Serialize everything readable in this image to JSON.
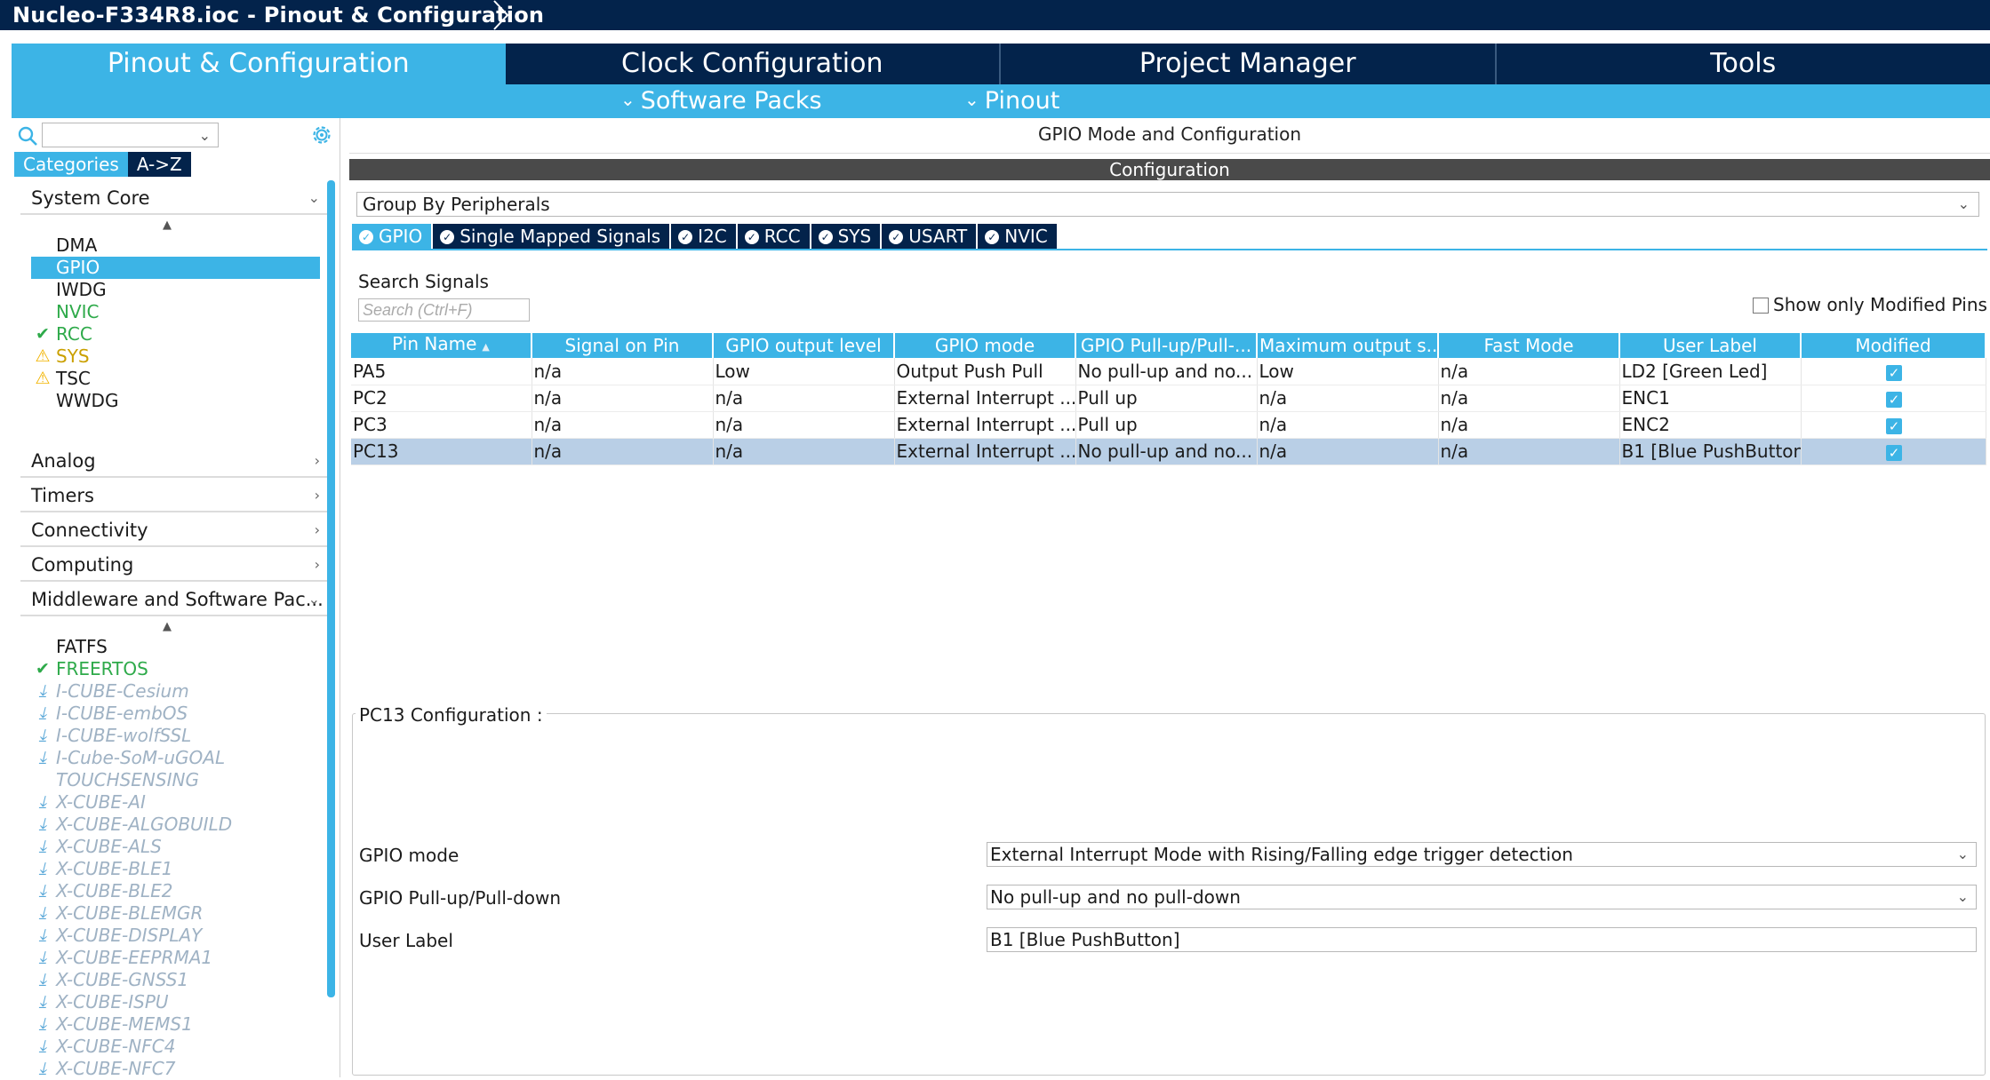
{
  "window": {
    "title": "Nucleo-F334R8.ioc - Pinout & Configuration"
  },
  "main_tabs": [
    {
      "label": "Pinout & Configuration",
      "active": true
    },
    {
      "label": "Clock Configuration",
      "active": false
    },
    {
      "label": "Project Manager",
      "active": false
    },
    {
      "label": "Tools",
      "active": false
    }
  ],
  "sub_tabs": [
    {
      "label": "Software Packs"
    },
    {
      "label": "Pinout"
    }
  ],
  "left_panel": {
    "search_value": "",
    "view_tabs": [
      "Categories",
      "A->Z"
    ],
    "system_core": {
      "title": "System Core",
      "items": [
        {
          "label": "DMA",
          "status": ""
        },
        {
          "label": "GPIO",
          "status": "selected"
        },
        {
          "label": "IWDG",
          "status": ""
        },
        {
          "label": "NVIC",
          "status": "green"
        },
        {
          "label": "RCC",
          "status": "check"
        },
        {
          "label": "SYS",
          "status": "warn"
        },
        {
          "label": "TSC",
          "status": "warn"
        },
        {
          "label": "WWDG",
          "status": ""
        }
      ]
    },
    "categories": [
      "Analog",
      "Timers",
      "Connectivity",
      "Computing"
    ],
    "middleware": {
      "title": "Middleware and Software Pac...",
      "items": [
        {
          "label": "FATFS",
          "status": ""
        },
        {
          "label": "FREERTOS",
          "status": "check"
        },
        {
          "label": "I-CUBE-Cesium",
          "status": "download"
        },
        {
          "label": "I-CUBE-embOS",
          "status": "download"
        },
        {
          "label": "I-CUBE-wolfSSL",
          "status": "download"
        },
        {
          "label": "I-Cube-SoM-uGOAL",
          "status": "download"
        },
        {
          "label": "TOUCHSENSING",
          "status": "disabled"
        },
        {
          "label": "X-CUBE-AI",
          "status": "download"
        },
        {
          "label": "X-CUBE-ALGOBUILD",
          "status": "download"
        },
        {
          "label": "X-CUBE-ALS",
          "status": "download"
        },
        {
          "label": "X-CUBE-BLE1",
          "status": "download"
        },
        {
          "label": "X-CUBE-BLE2",
          "status": "download"
        },
        {
          "label": "X-CUBE-BLEMGR",
          "status": "download"
        },
        {
          "label": "X-CUBE-DISPLAY",
          "status": "download"
        },
        {
          "label": "X-CUBE-EEPRMA1",
          "status": "download"
        },
        {
          "label": "X-CUBE-GNSS1",
          "status": "download"
        },
        {
          "label": "X-CUBE-ISPU",
          "status": "download"
        },
        {
          "label": "X-CUBE-MEMS1",
          "status": "download"
        },
        {
          "label": "X-CUBE-NFC4",
          "status": "download"
        },
        {
          "label": "X-CUBE-NFC7",
          "status": "download"
        }
      ]
    }
  },
  "right_panel": {
    "header": "GPIO Mode and Configuration",
    "config_title": "Configuration",
    "group_by": "Group By Peripherals",
    "peripheral_tabs": [
      {
        "label": "GPIO",
        "active": true
      },
      {
        "label": "Single Mapped Signals",
        "active": false
      },
      {
        "label": "I2C",
        "active": false
      },
      {
        "label": "RCC",
        "active": false
      },
      {
        "label": "SYS",
        "active": false
      },
      {
        "label": "USART",
        "active": false
      },
      {
        "label": "NVIC",
        "active": false
      }
    ],
    "search_label": "Search Signals",
    "search_placeholder": "Search (Ctrl+F)",
    "show_modified_label": "Show only Modified Pins",
    "table": {
      "columns": [
        "Pin Name",
        "Signal on Pin",
        "GPIO output level",
        "GPIO mode",
        "GPIO Pull-up/Pull-...",
        "Maximum output s...",
        "Fast Mode",
        "User Label",
        "Modified"
      ],
      "rows": [
        [
          "PA5",
          "n/a",
          "Low",
          "Output Push Pull",
          "No pull-up and no...",
          "Low",
          "n/a",
          "LD2 [Green Led]",
          "✓"
        ],
        [
          "PC2",
          "n/a",
          "n/a",
          "External Interrupt ...",
          "Pull up",
          "n/a",
          "n/a",
          "ENC1",
          "✓"
        ],
        [
          "PC3",
          "n/a",
          "n/a",
          "External Interrupt ...",
          "Pull up",
          "n/a",
          "n/a",
          "ENC2",
          "✓"
        ],
        [
          "PC13",
          "n/a",
          "n/a",
          "External Interrupt ...",
          "No pull-up and no...",
          "n/a",
          "n/a",
          "B1 [Blue PushButton]",
          "✓"
        ]
      ],
      "selected_row": 3
    },
    "pin_config": {
      "title": "PC13 Configuration :",
      "gpio_mode_label": "GPIO mode",
      "gpio_mode_value": "External Interrupt Mode with Rising/Falling edge trigger detection",
      "pull_label": "GPIO Pull-up/Pull-down",
      "pull_value": "No pull-up and no pull-down",
      "user_label_label": "User Label",
      "user_label_value": "B1 [Blue PushButton]"
    }
  },
  "colors": {
    "navy": "#03234b",
    "accent": "#3cb4e6",
    "green": "#2eaa4a",
    "warn": "#f2b400",
    "row_selected": "#b9cfe6"
  }
}
